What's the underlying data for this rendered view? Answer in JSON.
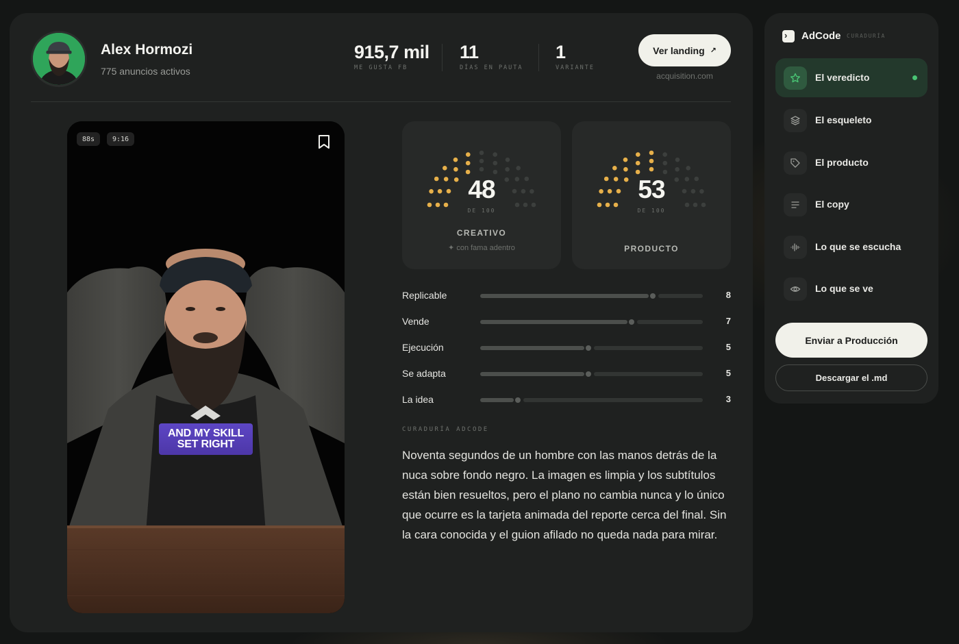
{
  "profile": {
    "name": "Alex Hormozi",
    "active_ads": "775 anuncios activos"
  },
  "stats": [
    {
      "value": "915,7 mil",
      "label": "ME GUSTA FB"
    },
    {
      "value": "11",
      "label": "DÍAS EN PAUTA"
    },
    {
      "value": "1",
      "label": "VARIANTE"
    }
  ],
  "landing": {
    "button_label": "Ver landing",
    "arrow": "↗",
    "domain": "acquisition.com"
  },
  "video": {
    "duration": "88s",
    "ratio": "9:16",
    "caption_line1": "AND MY SKILL",
    "caption_line2": "SET RIGHT",
    "bookmark_icon": "bookmark-icon"
  },
  "gauges": [
    {
      "score": 48,
      "max": 100,
      "of_label": "DE 100",
      "label": "CREATIVO",
      "note": "✦ con fama adentro",
      "color": "#e7b04a"
    },
    {
      "score": 53,
      "max": 100,
      "of_label": "DE 100",
      "label": "PRODUCTO",
      "note": "",
      "color": "#e7b04a"
    }
  ],
  "metrics": [
    {
      "label": "Replicable",
      "value": 8,
      "max": 10
    },
    {
      "label": "Vende",
      "value": 7,
      "max": 10
    },
    {
      "label": "Ejecución",
      "value": 5,
      "max": 10
    },
    {
      "label": "Se adapta",
      "value": 5,
      "max": 10
    },
    {
      "label": "La idea",
      "value": 3,
      "max": 10
    }
  ],
  "curation": {
    "label": "CURADURÍA ADCODE",
    "text": "Noventa segundos de un hombre con las manos detrás de la nuca sobre fondo negro. La imagen es limpia y los subtítulos están bien resueltos, pero el plano no cambia nunca y lo único que ocurre es la tarjeta animada del reporte cerca del final. Sin la cara conocida y el guion afilado no queda nada para mirar."
  },
  "sidebar": {
    "brand": "AdCode",
    "brand_sub": "CURADURÍA",
    "items": [
      {
        "label": "El veredicto",
        "icon": "star-icon",
        "active": true
      },
      {
        "label": "El esqueleto",
        "icon": "layers-icon",
        "active": false
      },
      {
        "label": "El producto",
        "icon": "tag-icon",
        "active": false
      },
      {
        "label": "El copy",
        "icon": "text-lines-icon",
        "active": false
      },
      {
        "label": "Lo que se escucha",
        "icon": "audio-wave-icon",
        "active": false
      },
      {
        "label": "Lo que se ve",
        "icon": "eye-icon",
        "active": false
      }
    ],
    "primary_button": "Enviar a Producción",
    "secondary_button": "Descargar el .md"
  },
  "colors": {
    "accent_green": "#49c474",
    "gauge_on": "#e7b04a",
    "gauge_off": "#3c3f3d"
  }
}
